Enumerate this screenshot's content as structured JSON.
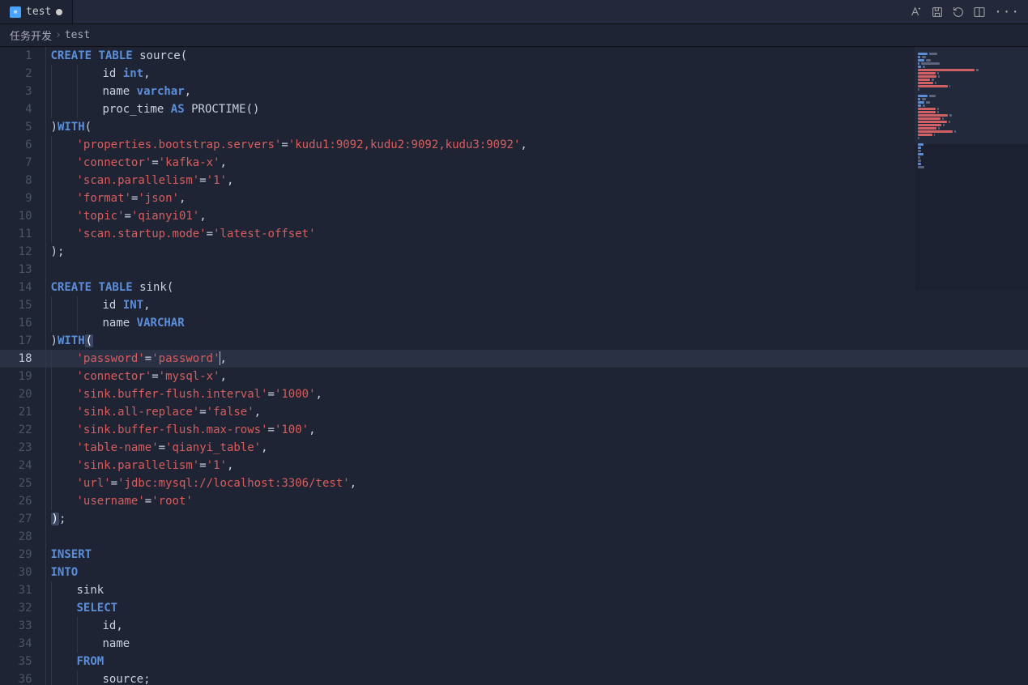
{
  "tabbar": {
    "tab_icon": "file-type-sql-icon",
    "tab_label": "test",
    "modified": true
  },
  "titlebar_icons": [
    "font-icon",
    "save-icon",
    "revert-icon",
    "split-icon",
    "more-icon"
  ],
  "breadcrumb": {
    "root": "任务开发",
    "file": "test"
  },
  "active_line": 18,
  "code": [
    {
      "n": 1,
      "i": 0,
      "seg": [
        [
          "kw",
          "CREATE"
        ],
        [
          "pn",
          " "
        ],
        [
          "kw",
          "TABLE"
        ],
        [
          "pn",
          " "
        ],
        [
          "id",
          "source"
        ],
        [
          "br",
          "("
        ]
      ]
    },
    {
      "n": 2,
      "i": 2,
      "seg": [
        [
          "id",
          "id"
        ],
        [
          "pn",
          " "
        ],
        [
          "ty",
          "int"
        ],
        [
          "pn",
          ","
        ]
      ]
    },
    {
      "n": 3,
      "i": 2,
      "seg": [
        [
          "id",
          "name"
        ],
        [
          "pn",
          " "
        ],
        [
          "ty",
          "varchar"
        ],
        [
          "pn",
          ","
        ]
      ]
    },
    {
      "n": 4,
      "i": 2,
      "seg": [
        [
          "id",
          "proc_time"
        ],
        [
          "pn",
          " "
        ],
        [
          "kw",
          "AS"
        ],
        [
          "pn",
          " "
        ],
        [
          "fn",
          "PROCTIME"
        ],
        [
          "br",
          "()"
        ]
      ]
    },
    {
      "n": 5,
      "i": 0,
      "seg": [
        [
          "br",
          ")"
        ],
        [
          "kw",
          "WITH"
        ],
        [
          "br",
          "("
        ]
      ]
    },
    {
      "n": 6,
      "i": 1,
      "seg": [
        [
          "str",
          "'properties.bootstrap.servers'"
        ],
        [
          "op",
          "="
        ],
        [
          "str",
          "'kudu1:9092,kudu2:9092,kudu3:9092'"
        ],
        [
          "pn",
          ","
        ]
      ]
    },
    {
      "n": 7,
      "i": 1,
      "seg": [
        [
          "str",
          "'connector'"
        ],
        [
          "op",
          "="
        ],
        [
          "str",
          "'kafka-x'"
        ],
        [
          "pn",
          ","
        ]
      ]
    },
    {
      "n": 8,
      "i": 1,
      "seg": [
        [
          "str",
          "'scan.parallelism'"
        ],
        [
          "op",
          "="
        ],
        [
          "str",
          "'1'"
        ],
        [
          "pn",
          ","
        ]
      ]
    },
    {
      "n": 9,
      "i": 1,
      "seg": [
        [
          "str",
          "'format'"
        ],
        [
          "op",
          "="
        ],
        [
          "str",
          "'json'"
        ],
        [
          "pn",
          ","
        ]
      ]
    },
    {
      "n": 10,
      "i": 1,
      "seg": [
        [
          "str",
          "'topic'"
        ],
        [
          "op",
          "="
        ],
        [
          "str",
          "'qianyi01'"
        ],
        [
          "pn",
          ","
        ]
      ]
    },
    {
      "n": 11,
      "i": 1,
      "seg": [
        [
          "str",
          "'scan.startup.mode'"
        ],
        [
          "op",
          "="
        ],
        [
          "str",
          "'latest-offset'"
        ]
      ]
    },
    {
      "n": 12,
      "i": 0,
      "seg": [
        [
          "br",
          ")"
        ],
        [
          "pn",
          ";"
        ]
      ]
    },
    {
      "n": 13,
      "i": 0,
      "seg": []
    },
    {
      "n": 14,
      "i": 0,
      "seg": [
        [
          "kw",
          "CREATE"
        ],
        [
          "pn",
          " "
        ],
        [
          "kw",
          "TABLE"
        ],
        [
          "pn",
          " "
        ],
        [
          "id",
          "sink"
        ],
        [
          "br",
          "("
        ]
      ]
    },
    {
      "n": 15,
      "i": 2,
      "seg": [
        [
          "id",
          "id"
        ],
        [
          "pn",
          " "
        ],
        [
          "ty",
          "INT"
        ],
        [
          "pn",
          ","
        ]
      ]
    },
    {
      "n": 16,
      "i": 2,
      "seg": [
        [
          "id",
          "name"
        ],
        [
          "pn",
          " "
        ],
        [
          "ty",
          "VARCHAR"
        ]
      ]
    },
    {
      "n": 17,
      "i": 0,
      "seg": [
        [
          "br",
          ")"
        ],
        [
          "kw",
          "WITH"
        ],
        [
          "brhl",
          "("
        ]
      ]
    },
    {
      "n": 18,
      "i": 1,
      "hl": true,
      "seg": [
        [
          "str",
          "'password'"
        ],
        [
          "op",
          "="
        ],
        [
          "str",
          "'password'"
        ],
        [
          "cursor",
          ""
        ],
        [
          "pn",
          ","
        ]
      ]
    },
    {
      "n": 19,
      "i": 1,
      "seg": [
        [
          "str",
          "'connector'"
        ],
        [
          "op",
          "="
        ],
        [
          "str",
          "'mysql-x'"
        ],
        [
          "pn",
          ","
        ]
      ]
    },
    {
      "n": 20,
      "i": 1,
      "seg": [
        [
          "str",
          "'sink.buffer-flush.interval'"
        ],
        [
          "op",
          "="
        ],
        [
          "str",
          "'1000'"
        ],
        [
          "pn",
          ","
        ]
      ]
    },
    {
      "n": 21,
      "i": 1,
      "seg": [
        [
          "str",
          "'sink.all-replace'"
        ],
        [
          "op",
          "="
        ],
        [
          "str",
          "'false'"
        ],
        [
          "pn",
          ","
        ]
      ]
    },
    {
      "n": 22,
      "i": 1,
      "seg": [
        [
          "str",
          "'sink.buffer-flush.max-rows'"
        ],
        [
          "op",
          "="
        ],
        [
          "str",
          "'100'"
        ],
        [
          "pn",
          ","
        ]
      ]
    },
    {
      "n": 23,
      "i": 1,
      "seg": [
        [
          "str",
          "'table-name'"
        ],
        [
          "op",
          "="
        ],
        [
          "str",
          "'qianyi_table'"
        ],
        [
          "pn",
          ","
        ]
      ]
    },
    {
      "n": 24,
      "i": 1,
      "seg": [
        [
          "str",
          "'sink.parallelism'"
        ],
        [
          "op",
          "="
        ],
        [
          "str",
          "'1'"
        ],
        [
          "pn",
          ","
        ]
      ]
    },
    {
      "n": 25,
      "i": 1,
      "seg": [
        [
          "str",
          "'url'"
        ],
        [
          "op",
          "="
        ],
        [
          "str",
          "'jdbc:mysql://localhost:3306/test'"
        ],
        [
          "pn",
          ","
        ]
      ]
    },
    {
      "n": 26,
      "i": 1,
      "seg": [
        [
          "str",
          "'username'"
        ],
        [
          "op",
          "="
        ],
        [
          "str",
          "'root'"
        ]
      ]
    },
    {
      "n": 27,
      "i": 0,
      "seg": [
        [
          "brhl",
          ")"
        ],
        [
          "pn",
          ";"
        ]
      ]
    },
    {
      "n": 28,
      "i": 0,
      "seg": []
    },
    {
      "n": 29,
      "i": 0,
      "seg": [
        [
          "kw",
          "INSERT"
        ]
      ]
    },
    {
      "n": 30,
      "i": 0,
      "seg": [
        [
          "kw",
          "INTO"
        ]
      ]
    },
    {
      "n": 31,
      "i": 1,
      "seg": [
        [
          "id",
          "sink"
        ]
      ]
    },
    {
      "n": 32,
      "i": 1,
      "seg": [
        [
          "kw",
          "SELECT"
        ]
      ]
    },
    {
      "n": 33,
      "i": 2,
      "seg": [
        [
          "id",
          "id"
        ],
        [
          "pn",
          ","
        ]
      ]
    },
    {
      "n": 34,
      "i": 2,
      "seg": [
        [
          "id",
          "name"
        ]
      ]
    },
    {
      "n": 35,
      "i": 1,
      "seg": [
        [
          "kw",
          "FROM"
        ]
      ]
    },
    {
      "n": 36,
      "i": 2,
      "seg": [
        [
          "id",
          "source"
        ],
        [
          "pn",
          ";"
        ]
      ]
    }
  ]
}
